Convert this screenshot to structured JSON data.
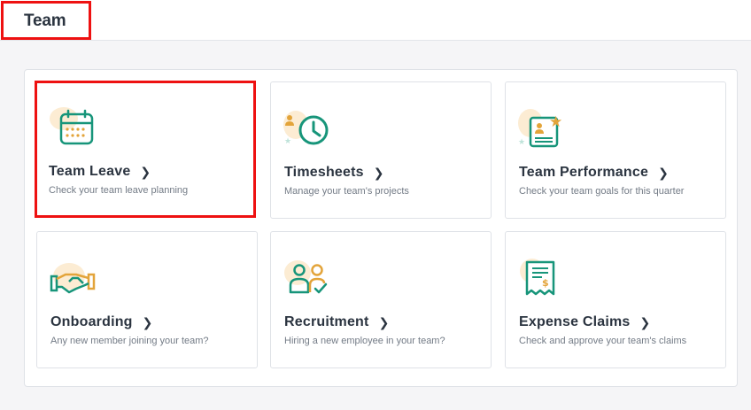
{
  "header": {
    "title": "Team"
  },
  "cards": [
    {
      "title": "Team Leave",
      "description": "Check your team leave planning",
      "icon": "calendar-icon"
    },
    {
      "title": "Timesheets",
      "description": "Manage your team's projects",
      "icon": "clock-icon"
    },
    {
      "title": "Team Performance",
      "description": "Check your team goals for this quarter",
      "icon": "performance-icon"
    },
    {
      "title": "Onboarding",
      "description": "Any new member joining your team?",
      "icon": "handshake-icon"
    },
    {
      "title": "Recruitment",
      "description": "Hiring a new employee in your team?",
      "icon": "recruitment-icon"
    },
    {
      "title": "Expense Claims",
      "description": "Check and approve your team's claims",
      "icon": "receipt-icon"
    }
  ],
  "colors": {
    "accent_green": "#17957a",
    "accent_orange": "#e3a43a",
    "blob": "#fcecd3",
    "highlight": "#ee1111"
  }
}
